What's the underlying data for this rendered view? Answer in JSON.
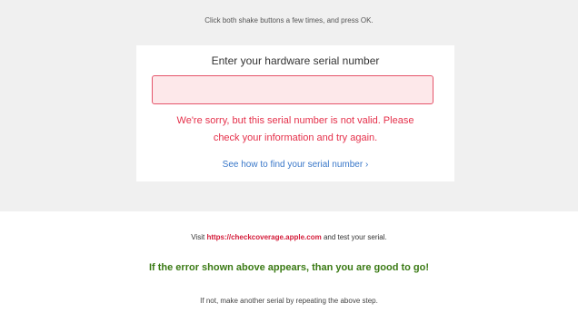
{
  "instruction": "Click both shake buttons a few times, and press OK.",
  "card": {
    "title": "Enter your hardware serial number",
    "input_value": "",
    "error_line1": "We're sorry, but this serial number is not valid. Please",
    "error_line2": "check your information and try again.",
    "help_link": "See how to find your serial number ›"
  },
  "footer": {
    "visit_prefix": "Visit",
    "visit_url": "https://checkcoverage.apple.com",
    "visit_suffix": "and test your serial.",
    "success": "If the error shown above appears, than you are good to go!",
    "note": "If not, make another serial by repeating the above step."
  },
  "colors": {
    "panel_bg": "#f0f0f0",
    "error": "#e5304a",
    "input_border": "#e5546a",
    "input_bg": "#fde8ea",
    "link": "#3a78c9",
    "url": "#d41c3a",
    "success": "#3a7a14"
  }
}
